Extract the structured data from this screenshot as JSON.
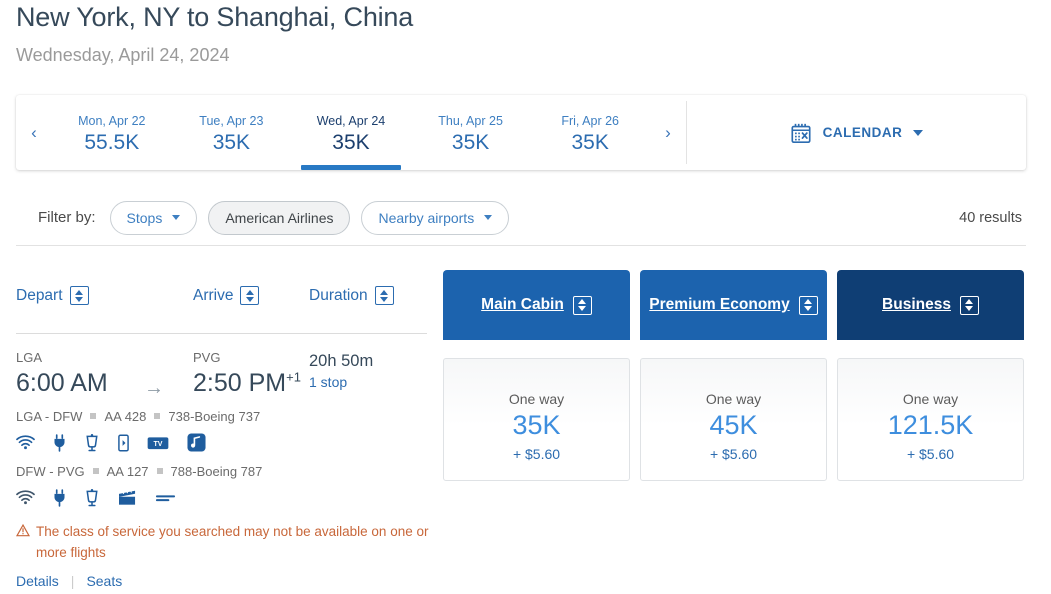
{
  "header": {
    "route_title": "New York, NY to Shanghai, China",
    "date_subtitle": "Wednesday, April 24, 2024"
  },
  "datebar": {
    "prev_label": "‹",
    "next_label": "›",
    "days": [
      {
        "label": "Mon, Apr 22",
        "price": "55.5K"
      },
      {
        "label": "Tue, Apr 23",
        "price": "35K"
      },
      {
        "label": "Wed, Apr 24",
        "price": "35K"
      },
      {
        "label": "Thu, Apr 25",
        "price": "35K"
      },
      {
        "label": "Fri, Apr 26",
        "price": "35K"
      }
    ],
    "active_index": 2,
    "calendar_label": "CALENDAR",
    "calendar_icon": "calendar-icon"
  },
  "filters": {
    "label": "Filter by:",
    "chips": [
      {
        "label": "Stops",
        "has_caret": true,
        "selected": false
      },
      {
        "label": "American Airlines",
        "has_caret": false,
        "selected": true
      },
      {
        "label": "Nearby airports",
        "has_caret": true,
        "selected": false
      }
    ],
    "results_count": "40 results"
  },
  "columns": {
    "depart": "Depart",
    "arrive": "Arrive",
    "duration": "Duration"
  },
  "cabin_tabs": [
    {
      "label": "Main Cabin",
      "style": "std"
    },
    {
      "label": "Premium Economy",
      "style": "std"
    },
    {
      "label": "Business",
      "style": "dark"
    }
  ],
  "flight": {
    "depart_airport": "LGA",
    "depart_time": "6:00 AM",
    "arrow": "→",
    "arrive_airport": "PVG",
    "arrive_time": "2:50 PM",
    "arrive_day_offset": "+1",
    "duration": "20h 50m",
    "stops": "1 stop",
    "segments": [
      {
        "route": "LGA - DFW",
        "flight_no": "AA 428",
        "aircraft": "738-Boeing 737",
        "amenities": [
          "wifi-icon",
          "power-outlet-icon",
          "beverage-icon",
          "device-streaming-icon",
          "tv-icon",
          "music-icon"
        ]
      },
      {
        "route": "DFW - PVG",
        "flight_no": "AA 127",
        "aircraft": "788-Boeing 787",
        "amenities": [
          "wifi-icon",
          "power-outlet-icon",
          "beverage-icon",
          "movie-icon",
          "lie-flat-seat-icon"
        ]
      }
    ],
    "warning": "The class of service you searched may not be available on one or more flights",
    "details_link": "Details",
    "seats_link": "Seats",
    "link_separator": "|"
  },
  "price_cards": [
    {
      "label": "One way",
      "price": "35K",
      "tax": "+ $5.60"
    },
    {
      "label": "One way",
      "price": "45K",
      "tax": "+ $5.60"
    },
    {
      "label": "One way",
      "price": "121.5K",
      "tax": "+ $5.60"
    }
  ],
  "colors": {
    "brand_blue": "#2c6cb0",
    "tab_blue": "#1c63ae",
    "tab_dark_navy": "#0f3e74",
    "price_blue": "#3e8ede",
    "warning_orange": "#c8673a",
    "title_slate": "#36495a"
  }
}
